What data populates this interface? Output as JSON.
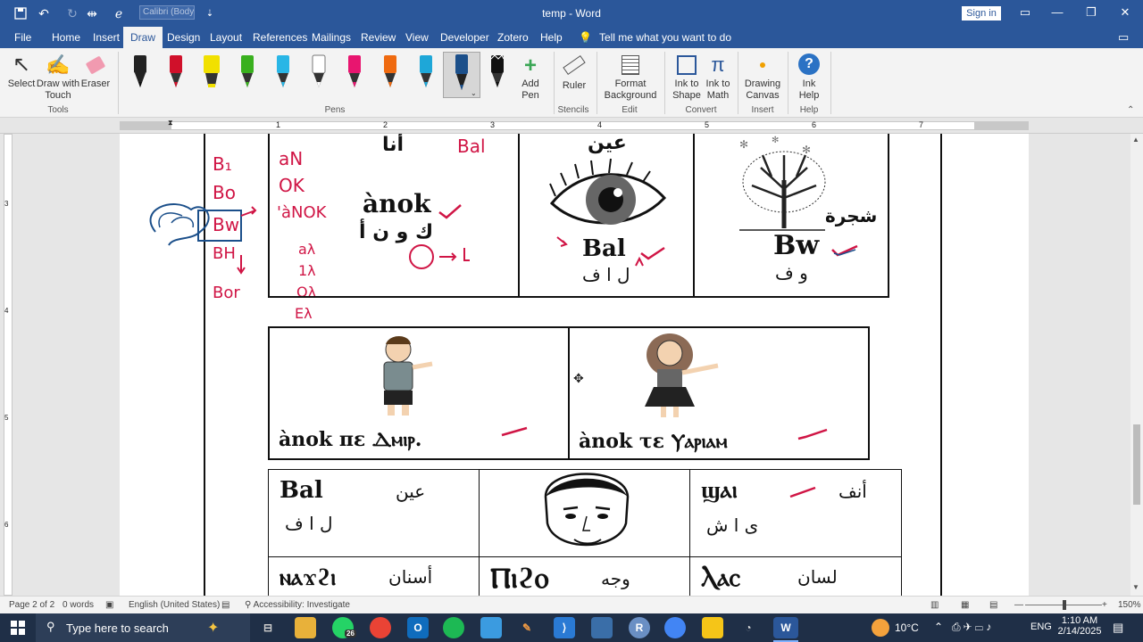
{
  "titlebar": {
    "font_name": "Calibri (Body",
    "doc_title": "temp  -  Word",
    "sign_in": "Sign in"
  },
  "menu": {
    "tabs": [
      "File",
      "Home",
      "Insert",
      "Draw",
      "Design",
      "Layout",
      "References",
      "Mailings",
      "Review",
      "View",
      "Developer",
      "Zotero",
      "Help"
    ],
    "active": "Draw",
    "tell_me": "Tell me what you want to do"
  },
  "ribbon": {
    "tools": {
      "select": "Select",
      "draw_touch": "Draw with Touch",
      "eraser": "Eraser",
      "group": "Tools"
    },
    "pens_group": "Pens",
    "pen_colors": [
      "#111111",
      "#d0102a",
      "#f1e000",
      "#39b01e",
      "#29b6e6",
      "#ffffff",
      "#e8156f",
      "#ef6a10",
      "#1ea7d8",
      "#1b4f8a",
      "#111111"
    ],
    "add_pen": "Add Pen",
    "stencils": {
      "ruler": "Ruler",
      "group": "Stencils"
    },
    "edit": {
      "format_background": "Format Background",
      "group": "Edit"
    },
    "convert": {
      "ink_to_shape": "Ink to Shape",
      "ink_to_math": "Ink to Math",
      "group": "Convert"
    },
    "insert": {
      "drawing_canvas": "Drawing Canvas",
      "group": "Insert"
    },
    "help": {
      "ink_help": "Ink Help",
      "group": "Help"
    }
  },
  "ruler": {
    "numbers": [
      "1",
      "2",
      "3",
      "4",
      "5",
      "6",
      "7"
    ],
    "vnumbers": [
      "3",
      "4",
      "5",
      "6"
    ]
  },
  "document": {
    "row1": {
      "cell1": {
        "arabic_top": "أنا",
        "coptic": "ànok",
        "arabic_letters": "ك و ن أ"
      },
      "cell2": {
        "arabic_top": "عين",
        "coptic": "Bal",
        "arabic_letters": "ل ا ف"
      },
      "cell3": {
        "arabic_top": "شجرة",
        "coptic": "Bw",
        "arabic_letters": "و ف"
      }
    },
    "row2": {
      "cell1": {
        "caption": "ànok πε Ⲇⲙⲓⲣ."
      },
      "cell2": {
        "caption": "ànok τε Ⲩⲁⲣⲓⲁⲙ"
      }
    },
    "row3": {
      "cell1": {
        "coptic": "Bal",
        "arabic": "عين",
        "arabic_letters": "ل ا ف"
      },
      "cell3": {
        "coptic": "ϣⲁⲓ",
        "arabic": "أنف",
        "arabic_letters": "ى ا ش"
      }
    },
    "row4": {
      "cell1": {
        "coptic": "ⲛⲁϫϩⲓ",
        "arabic": "أسنان"
      },
      "cell2": {
        "coptic": "Ⲡⲓϩⲟ",
        "arabic": "وجه"
      },
      "cell3": {
        "coptic": "Ⲗⲁⲥ",
        "arabic": "لسان"
      }
    },
    "margin_ink": {
      "left_col": [
        "B₁",
        "Bo",
        "Bw",
        "BH",
        "Bor"
      ],
      "mid_col": [
        "aN",
        "OK",
        "'àNOK",
        "aλ",
        "1λ",
        "Oλ",
        "Eλ"
      ],
      "top_note": "Bal"
    }
  },
  "status": {
    "page": "Page 2 of 2",
    "words": "0 words",
    "language": "English (United States)",
    "accessibility": "Accessibility: Investigate",
    "zoom": "150%"
  },
  "taskbar": {
    "search_placeholder": "Type here to search",
    "weather": "10°C",
    "lang": "ENG",
    "time": "1:10 AM",
    "date": "2/14/2025",
    "whatsapp_badge": "26"
  }
}
